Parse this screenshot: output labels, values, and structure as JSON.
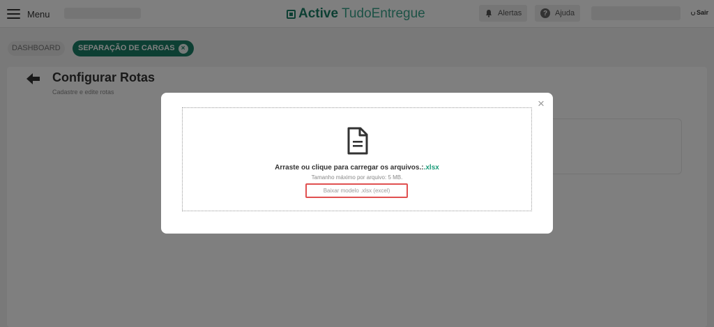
{
  "header": {
    "menu_label": "Menu",
    "brand_bold": "Active",
    "brand_rest": "TudoEntregue",
    "alerts_label": "Alertas",
    "help_label": "Ajuda",
    "help_glyph": "?",
    "logout_label": "Sair"
  },
  "tabs": {
    "dashboard_label": "DASHBOARD",
    "active_label": "SEPARAÇÃO DE CARGAS",
    "close_glyph": "×"
  },
  "page": {
    "title": "Configurar Rotas",
    "subtitle": "Cadastre e edite rotas"
  },
  "modal": {
    "close_glyph": "×",
    "drop_text": "Arraste ou clique para carregar os arquivos.:",
    "drop_extension": ".xlsx",
    "max_size_text": "Tamanho máximo por arquivo: 5 MB.",
    "download_label": "Baixar modelo .xlsx (excel)"
  },
  "colors": {
    "brand_green": "#1a7f66",
    "accent_teal": "#1a9b79",
    "highlight_red": "#e05050"
  },
  "icons": [
    "menu-icon",
    "alert-bell-icon",
    "help-icon",
    "logout-icon",
    "back-arrow-icon",
    "file-document-icon",
    "close-icon"
  ]
}
